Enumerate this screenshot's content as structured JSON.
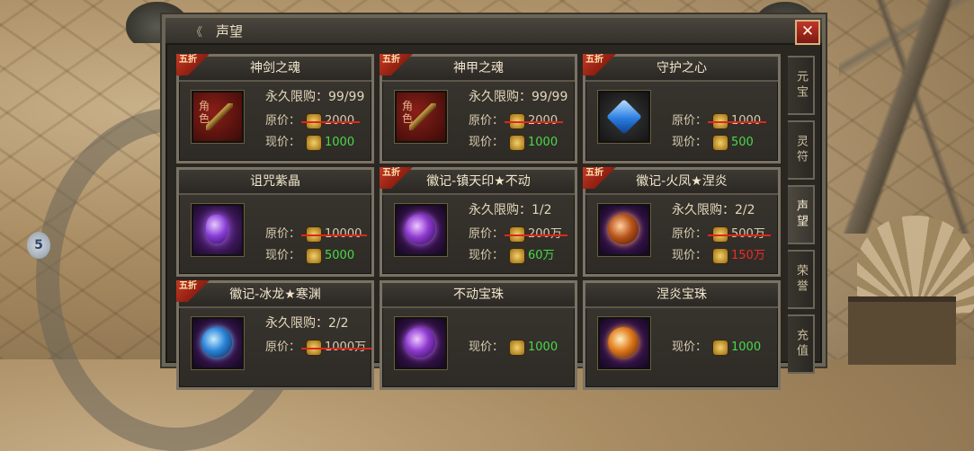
{
  "window": {
    "title": "声望",
    "title_arrow": "《",
    "close_label": "✕"
  },
  "side_badge": "5",
  "tabs": [
    {
      "label": "元宝"
    },
    {
      "label": "灵符"
    },
    {
      "label": "声望",
      "active": true
    },
    {
      "label": "荣誉"
    },
    {
      "label": "充值"
    }
  ],
  "labels": {
    "original_price": "原价：",
    "current_price": "现价：",
    "discount": "五折",
    "item_type_role": "角色"
  },
  "items": [
    {
      "name": "神剑之魂",
      "discount": true,
      "limit": "永久限购：99/99",
      "original": "2000",
      "current": "1000",
      "current_color": "green",
      "icon": "sword-soul-icon"
    },
    {
      "name": "神甲之魂",
      "discount": true,
      "limit": "永久限购：99/99",
      "original": "2000",
      "current": "1000",
      "current_color": "green",
      "icon": "armor-soul-icon"
    },
    {
      "name": "守护之心",
      "discount": true,
      "limit": "",
      "original": "1000",
      "current": "500",
      "current_color": "green",
      "icon": "blue-heart-gem-icon"
    },
    {
      "name": "诅咒紫晶",
      "discount": false,
      "limit": "",
      "original": "10000",
      "current": "5000",
      "current_color": "green",
      "icon": "purple-crystal-icon"
    },
    {
      "name": "徽记-镇天印★不动",
      "discount": true,
      "limit": "永久限购：1/2",
      "original": "200万",
      "current": "60万",
      "current_color": "green",
      "icon": "seal-badge-icon"
    },
    {
      "name": "徽记-火凤★涅炎",
      "discount": true,
      "limit": "永久限购：2/2",
      "original": "500万",
      "current": "150万",
      "current_color": "red",
      "icon": "fire-phoenix-badge-icon"
    },
    {
      "name": "徽记-冰龙★寒渊",
      "discount": true,
      "limit": "永久限购：2/2",
      "original": "1000万",
      "current": "",
      "current_color": "green",
      "icon": "ice-dragon-badge-icon"
    },
    {
      "name": "不动宝珠",
      "discount": false,
      "limit": "",
      "original": "",
      "current": "1000",
      "current_color": "green",
      "icon": "purple-orb-icon"
    },
    {
      "name": "涅炎宝珠",
      "discount": false,
      "limit": "",
      "original": "",
      "current": "1000",
      "current_color": "green",
      "icon": "fire-orb-icon"
    }
  ]
}
